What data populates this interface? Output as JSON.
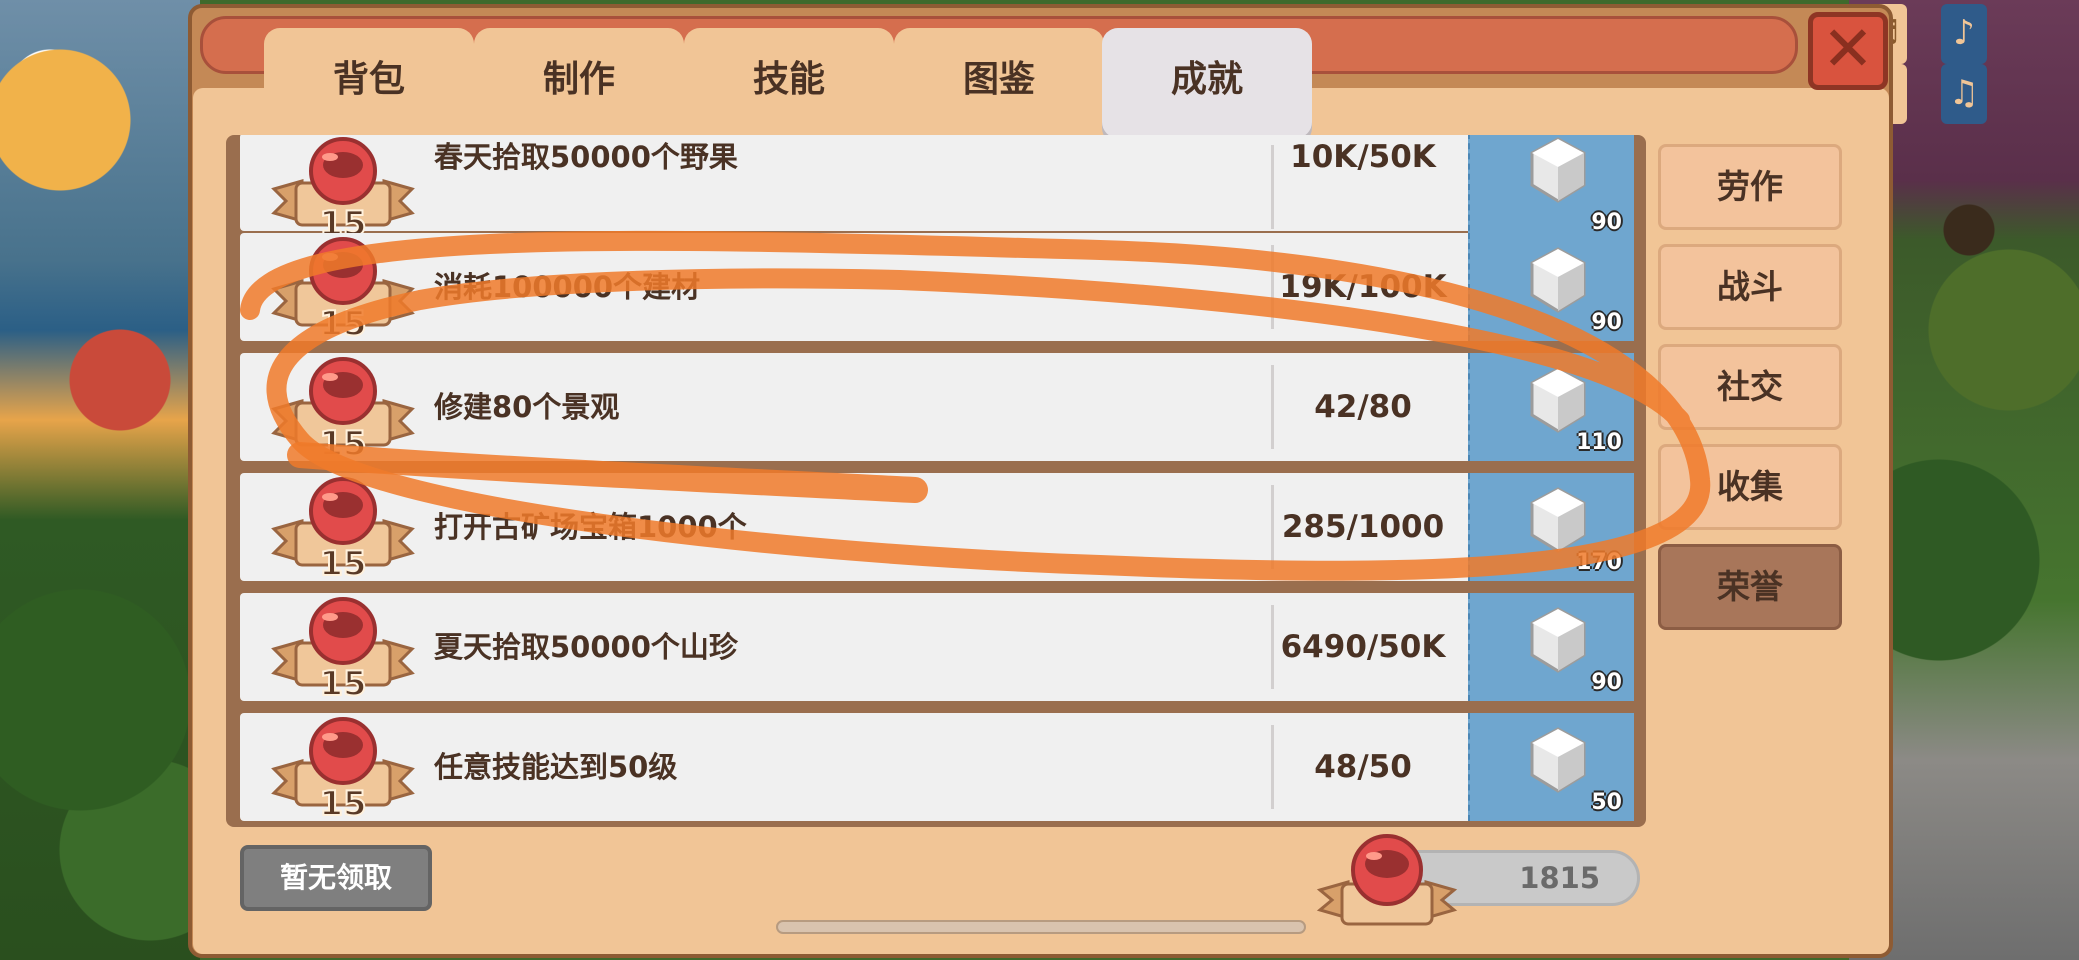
{
  "tabs": [
    {
      "label": "背包",
      "active": false
    },
    {
      "label": "制作",
      "active": false
    },
    {
      "label": "技能",
      "active": false
    },
    {
      "label": "图鉴",
      "active": false
    },
    {
      "label": "成就",
      "active": true
    }
  ],
  "close_icon": "✕",
  "achievements": [
    {
      "medal_level": "15",
      "description": "春天拾取50000个野果",
      "progress": "10K/50K",
      "reward_icon": "silver-gem",
      "reward_amount": "90"
    },
    {
      "medal_level": "15",
      "description": "消耗100000个建材",
      "progress": "19K/100K",
      "reward_icon": "silver-gem",
      "reward_amount": "90"
    },
    {
      "medal_level": "15",
      "description": "修建80个景观",
      "progress": "42/80",
      "reward_icon": "silver-gem",
      "reward_amount": "110"
    },
    {
      "medal_level": "15",
      "description": "打开古矿场宝箱1000个",
      "progress": "285/1000",
      "reward_icon": "silver-gem",
      "reward_amount": "170"
    },
    {
      "medal_level": "15",
      "description": "夏天拾取50000个山珍",
      "progress": "6490/50K",
      "reward_icon": "silver-gem",
      "reward_amount": "90"
    },
    {
      "medal_level": "15",
      "description": "任意技能达到50级",
      "progress": "48/50",
      "reward_icon": "silver-gem",
      "reward_amount": "50"
    }
  ],
  "categories": [
    {
      "label": "劳作",
      "active": false
    },
    {
      "label": "战斗",
      "active": false
    },
    {
      "label": "社交",
      "active": false
    },
    {
      "label": "收集",
      "active": false
    },
    {
      "label": "荣誉",
      "active": true
    }
  ],
  "claim_button": "暂无领取",
  "total_points": "1815",
  "colors": {
    "annotation_stroke": "#f07a2a",
    "medal_red": "#e14b4b",
    "reward_bg": "#6fa6cf",
    "active_category": "#a8765a"
  }
}
